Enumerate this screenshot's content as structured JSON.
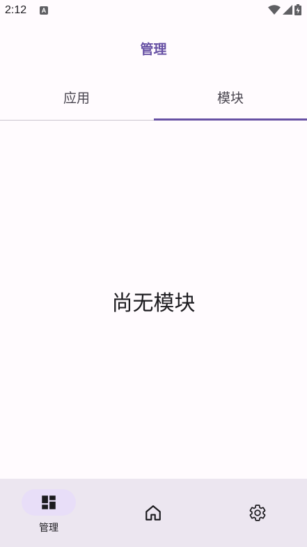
{
  "status_bar": {
    "time": "2:12",
    "notification_icon": "a-icon",
    "wifi_icon": "wifi-icon",
    "signal_icon": "signal-icon",
    "battery_icon": "battery-charging-icon"
  },
  "header": {
    "title": "管理"
  },
  "tabs": [
    {
      "label": "应用",
      "selected": false
    },
    {
      "label": "模块",
      "selected": true
    }
  ],
  "main": {
    "empty_message": "尚无模块"
  },
  "bottom_nav": [
    {
      "label": "管理",
      "icon": "dashboard-icon",
      "selected": true
    },
    {
      "label": "",
      "icon": "home-icon",
      "selected": false
    },
    {
      "label": "",
      "icon": "settings-icon",
      "selected": false
    }
  ],
  "colors": {
    "accent": "#6750a4",
    "nav_background": "#ece6f0",
    "nav_pill": "#e8def8",
    "background": "#fffbfe"
  }
}
